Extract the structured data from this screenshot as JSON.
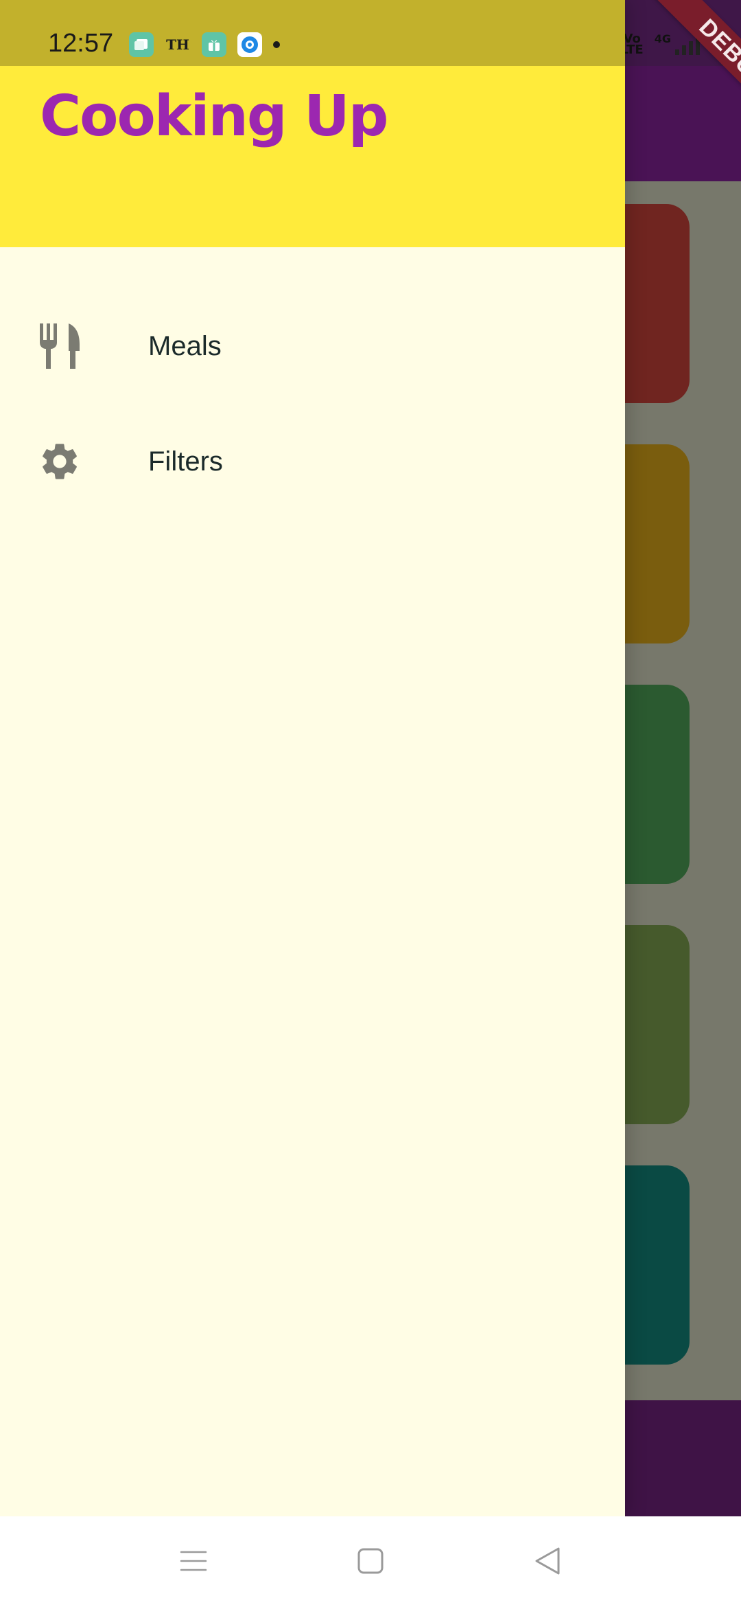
{
  "status_bar": {
    "time": "12:57",
    "notification_icons": [
      "app-icon",
      "th-icon",
      "gift-icon",
      "target-icon",
      "dot-icon"
    ],
    "system_icons": [
      "bluetooth-icon",
      "volte-icon",
      "4g-signal-icon",
      "signal-icon"
    ],
    "volte_text": "Vo\nLTE",
    "network": "4G"
  },
  "debug_banner": "DEBUG",
  "drawer": {
    "title": "Cooking Up",
    "items": [
      {
        "label": "Meals",
        "icon": "restaurant-icon"
      },
      {
        "label": "Filters",
        "icon": "settings-gear-icon"
      }
    ]
  },
  "background_app": {
    "category_cards": 5
  },
  "navigation_bar": {
    "buttons": [
      "recents-menu-icon",
      "home-icon",
      "back-icon"
    ]
  },
  "colors": {
    "drawer_background": "#fffde5",
    "header_yellow": "#ffeb3b",
    "title_purple": "#9c27b0",
    "label_text": "#1b2a2a",
    "icon_gray": "#7b7b72"
  }
}
